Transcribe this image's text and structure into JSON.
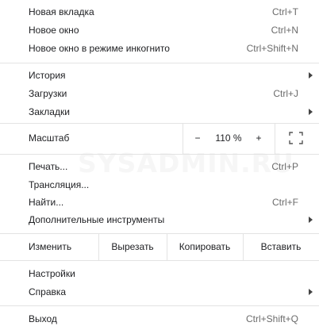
{
  "menu": {
    "section1": [
      {
        "label": "Новая вкладка",
        "shortcut": "Ctrl+T"
      },
      {
        "label": "Новое окно",
        "shortcut": "Ctrl+N"
      },
      {
        "label": "Новое окно в режиме инкогнито",
        "shortcut": "Ctrl+Shift+N"
      }
    ],
    "section2": [
      {
        "label": "История",
        "shortcut": "",
        "submenu": true
      },
      {
        "label": "Загрузки",
        "shortcut": "Ctrl+J"
      },
      {
        "label": "Закладки",
        "shortcut": "",
        "submenu": true
      }
    ],
    "zoom": {
      "label": "Масштаб",
      "minus": "−",
      "value": "110 %",
      "plus": "+",
      "fullscreen_icon": "fullscreen-icon"
    },
    "section3": [
      {
        "label": "Печать...",
        "shortcut": "Ctrl+P"
      },
      {
        "label": "Трансляция...",
        "shortcut": ""
      },
      {
        "label": "Найти...",
        "shortcut": "Ctrl+F"
      },
      {
        "label": "Дополнительные инструменты",
        "shortcut": "",
        "submenu": true
      }
    ],
    "edit": {
      "label": "Изменить",
      "cut": "Вырезать",
      "copy": "Копировать",
      "paste": "Вставить"
    },
    "section4": [
      {
        "label": "Настройки",
        "shortcut": ""
      },
      {
        "label": "Справка",
        "shortcut": "",
        "submenu": true
      }
    ],
    "section5": [
      {
        "label": "Выход",
        "shortcut": "Ctrl+Shift+Q"
      }
    ]
  },
  "watermark": "SYSADMIN.RU",
  "colors": {
    "text": "#202124",
    "shortcut": "#6b6b6b",
    "separator": "#e3e3e3"
  }
}
